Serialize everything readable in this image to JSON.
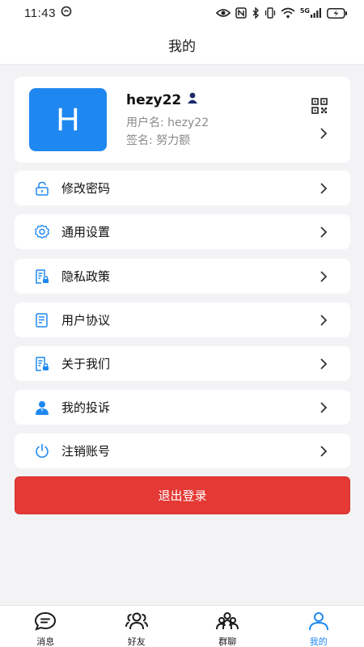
{
  "status_bar": {
    "time": "11:43",
    "network": "5G"
  },
  "header": {
    "title": "我的"
  },
  "profile": {
    "avatar_letter": "H",
    "name": "hezy22",
    "username_line": "用户名: hezy22",
    "signature_line": "签名: 努力额"
  },
  "menu": {
    "items": [
      {
        "label": "修改密码",
        "icon": "lock-icon"
      },
      {
        "label": "通用设置",
        "icon": "gear-icon"
      },
      {
        "label": "隐私政策",
        "icon": "document-lock-icon"
      },
      {
        "label": "用户协议",
        "icon": "document-icon"
      },
      {
        "label": "关于我们",
        "icon": "document-lock-icon"
      },
      {
        "label": "我的投诉",
        "icon": "person-icon"
      },
      {
        "label": "注销账号",
        "icon": "power-icon"
      }
    ]
  },
  "logout": {
    "label": "退出登录"
  },
  "tab_bar": {
    "tabs": [
      {
        "label": "消息",
        "icon": "chat-icon"
      },
      {
        "label": "好友",
        "icon": "friends-icon"
      },
      {
        "label": "群聊",
        "icon": "group-icon"
      },
      {
        "label": "我的",
        "icon": "profile-icon",
        "active": true
      }
    ]
  },
  "colors": {
    "accent": "#1f88f0",
    "danger": "#e53935",
    "background": "#f3f3f5"
  }
}
